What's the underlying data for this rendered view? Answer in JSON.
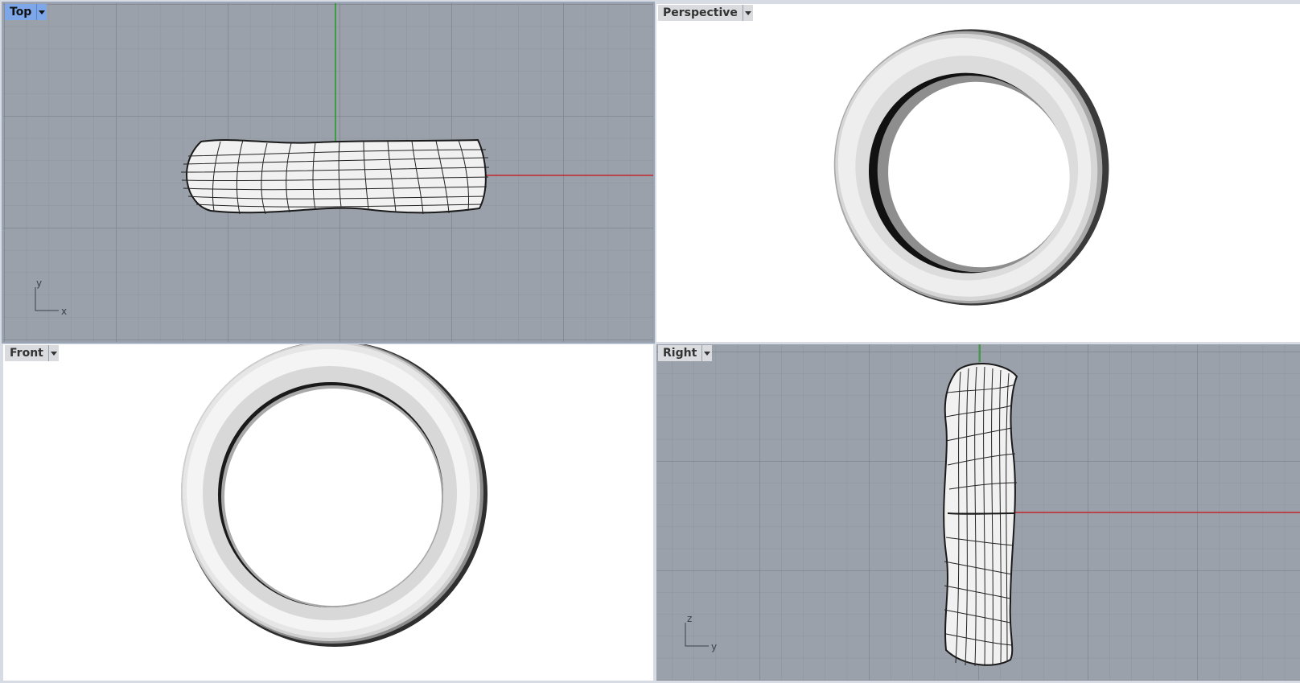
{
  "viewports": [
    {
      "id": "top",
      "title": "Top",
      "active": true,
      "display_mode": "wireframe",
      "axes": {
        "horizontal": "x",
        "vertical": "y"
      }
    },
    {
      "id": "perspective",
      "title": "Perspective",
      "active": false,
      "display_mode": "shaded"
    },
    {
      "id": "front",
      "title": "Front",
      "active": false,
      "display_mode": "shaded"
    },
    {
      "id": "right",
      "title": "Right",
      "active": false,
      "display_mode": "wireframe",
      "axes": {
        "horizontal": "y",
        "vertical": "z"
      }
    }
  ],
  "icons": {
    "viewport_menu": "triangle-down-icon"
  },
  "colors": {
    "grid_background": "#9ba1aa",
    "grid_minor": "#8e949d",
    "grid_major": "#7b8089",
    "x_axis": "#c1272d",
    "y_axis": "#1a9a1a",
    "active_tab": "#7da7e8",
    "shaded_background": "#ffffff"
  }
}
